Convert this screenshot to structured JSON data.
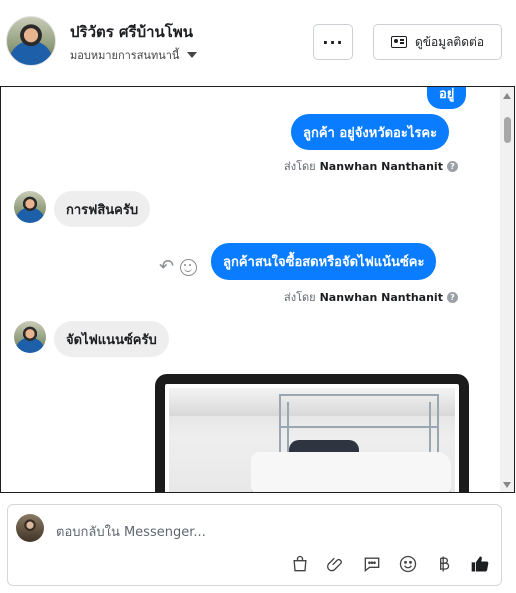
{
  "header": {
    "contact_name": "ปริวัตร ศรีบ้านโพน",
    "assign_label": "มอบหมายการสนทนานี้",
    "more_label": "···",
    "contact_button_label": "ดูข้อมูลติดต่อ"
  },
  "messages": [
    {
      "type": "outgoing",
      "text": "อยู่"
    },
    {
      "type": "outgoing",
      "text": "ลูกค้า อยู่จังหวัดอะไรคะ",
      "sent_by_prefix": "ส่งโดย",
      "sent_by": "Nanwhan Nanthanit"
    },
    {
      "type": "incoming",
      "text": "การฟสินครับ"
    },
    {
      "type": "outgoing",
      "text": "ลูกค้าสนใจซื้อสดหรือจัดไฟแน้นซ์คะ",
      "sent_by_prefix": "ส่งโดย",
      "sent_by": "Nanwhan Nanthanit"
    },
    {
      "type": "incoming",
      "text": "จัดไฟแนนซ์ครับ"
    },
    {
      "type": "incoming-image",
      "icon": "truck-photo"
    }
  ],
  "composer": {
    "placeholder": "ตอบกลับใน Messenger...",
    "tools": [
      "shopping-bag-icon",
      "paperclip-icon",
      "saved-reply-icon",
      "emoji-icon",
      "baht-icon",
      "thumbs-up-icon"
    ]
  },
  "colors": {
    "outgoing_bubble": "#0a7cff",
    "incoming_bubble": "#eeeeee",
    "like_icon": "#1c1e21"
  }
}
